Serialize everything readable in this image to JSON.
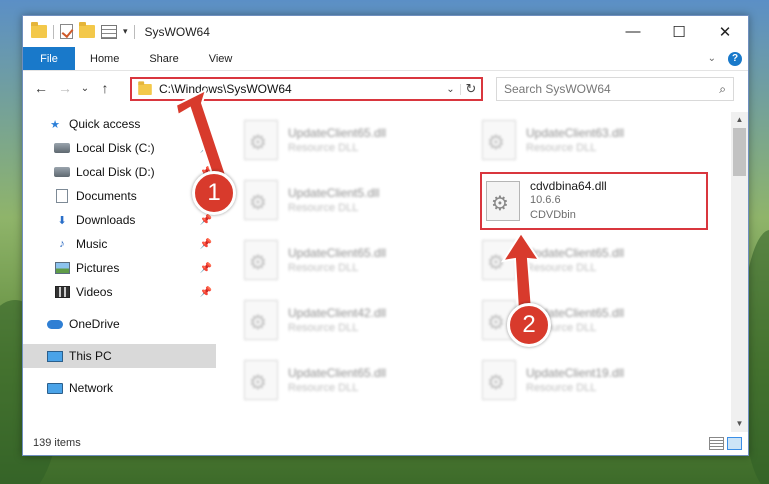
{
  "window": {
    "title": "SysWOW64",
    "minimize": "—",
    "maximize": "☐",
    "close": "✕"
  },
  "ribbon": {
    "tabs": [
      "File",
      "Home",
      "Share",
      "View"
    ],
    "expand": "⌄",
    "help": "?"
  },
  "nav": {
    "back": "←",
    "forward": "→",
    "recent": "⌄",
    "up": "↑"
  },
  "address": {
    "path": "C:\\Windows\\SysWOW64",
    "dropdown": "⌄",
    "refresh": "↻"
  },
  "search": {
    "placeholder": "Search SysWOW64",
    "icon": "⌕"
  },
  "sidebar": {
    "items": [
      {
        "label": "Quick access",
        "icon": "star-icon"
      },
      {
        "label": "Local Disk (C:)",
        "icon": "disk-icon",
        "pinned": true
      },
      {
        "label": "Local Disk (D:)",
        "icon": "disk-icon",
        "pinned": true
      },
      {
        "label": "Documents",
        "icon": "documents-icon",
        "pinned": true
      },
      {
        "label": "Downloads",
        "icon": "downloads-icon",
        "pinned": true
      },
      {
        "label": "Music",
        "icon": "music-icon",
        "pinned": true
      },
      {
        "label": "Pictures",
        "icon": "pictures-icon",
        "pinned": true
      },
      {
        "label": "Videos",
        "icon": "videos-icon",
        "pinned": true
      },
      {
        "label": "OneDrive",
        "icon": "onedrive-icon"
      },
      {
        "label": "This PC",
        "icon": "pc-icon",
        "selected": true
      },
      {
        "label": "Network",
        "icon": "network-icon"
      }
    ],
    "pin_glyph": "📌"
  },
  "files": [
    {
      "name": "UpdateClient65.dll",
      "desc": "Resource DLL"
    },
    {
      "name": "UpdateClient63.dll",
      "desc": "Resource DLL"
    },
    {
      "name": "UpdateClient5.dll",
      "desc": "Resource DLL"
    },
    {
      "name": "cdvdbina64.dll",
      "version": "10.6.6",
      "desc": "CDVDbin",
      "highlighted": true
    },
    {
      "name": "UpdateClient65.dll",
      "desc": "Resource DLL"
    },
    {
      "name": "UpdateClient65.dll",
      "desc": "Resource DLL"
    },
    {
      "name": "UpdateClient42.dll",
      "desc": "Resource DLL"
    },
    {
      "name": "UpdateClient65.dll",
      "desc": "Resource DLL"
    },
    {
      "name": "UpdateClient65.dll",
      "desc": "Resource DLL"
    },
    {
      "name": "UpdateClient19.dll",
      "desc": "Resource DLL"
    }
  ],
  "status": {
    "count": "139 items"
  },
  "callouts": {
    "one": "1",
    "two": "2"
  },
  "colors": {
    "accent": "#1979ca",
    "highlight": "#d9363e",
    "callout": "#d83a2c"
  }
}
